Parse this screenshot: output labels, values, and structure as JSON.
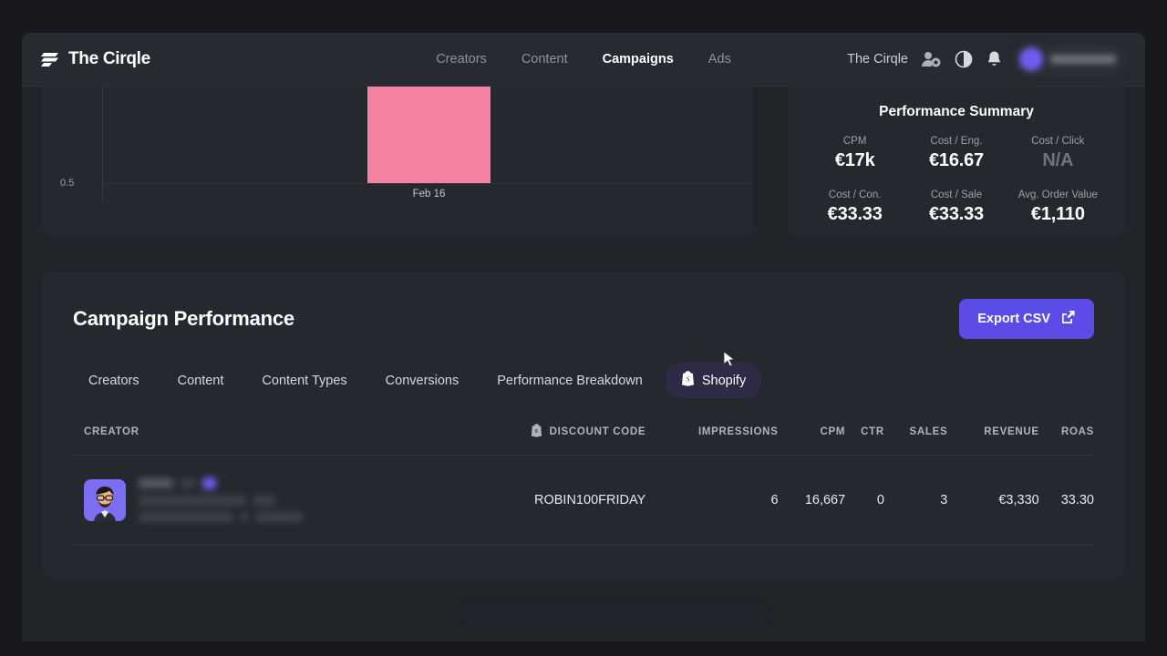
{
  "navbar": {
    "brand": "The Cirqle",
    "brand_icon": "stacked-bars-logo-icon",
    "links": [
      {
        "label": "Creators",
        "active": false
      },
      {
        "label": "Content",
        "active": false
      },
      {
        "label": "Campaigns",
        "active": true
      },
      {
        "label": "Ads",
        "active": false
      }
    ],
    "org_name": "The Cirqle",
    "icons": [
      "user-settings-icon",
      "theme-toggle-icon",
      "notifications-bell-icon"
    ],
    "account_pill": "redacted"
  },
  "chart_data": {
    "type": "bar",
    "title": "",
    "categories": [
      "Feb 16"
    ],
    "values": [
      1
    ],
    "ylabel": "",
    "xlabel": "",
    "ytick_labels": [
      "0.5"
    ],
    "ylim": [
      0,
      1
    ],
    "grid": true,
    "legend": "none",
    "bar_color": "#f4819f",
    "note": "chart is vertically clipped by the sticky header; only the 0.5 gridline and the single Feb 16 bar are visible"
  },
  "summary": {
    "title": "Performance Summary",
    "metrics": [
      {
        "label": "CPM",
        "value": "€17k"
      },
      {
        "label": "Cost / Eng.",
        "value": "€16.67"
      },
      {
        "label": "Cost / Click",
        "value": "N/A"
      },
      {
        "label": "Cost / Con.",
        "value": "€33.33"
      },
      {
        "label": "Cost / Sale",
        "value": "€33.33"
      },
      {
        "label": "Avg. Order Value",
        "value": "€1,110"
      }
    ]
  },
  "performance": {
    "title": "Campaign Performance",
    "export_label": "Export CSV",
    "export_icon": "external-link-icon",
    "tabs": [
      {
        "label": "Creators",
        "active": false,
        "icon": null
      },
      {
        "label": "Content",
        "active": false,
        "icon": null
      },
      {
        "label": "Content Types",
        "active": false,
        "icon": null
      },
      {
        "label": "Conversions",
        "active": false,
        "icon": null
      },
      {
        "label": "Performance Breakdown",
        "active": false,
        "icon": null
      },
      {
        "label": "Shopify",
        "active": true,
        "icon": "shopify-bag-icon"
      }
    ],
    "table": {
      "columns": [
        "CREATOR",
        "DISCOUNT CODE",
        "IMPRESSIONS",
        "CPM",
        "CTR",
        "SALES",
        "REVENUE",
        "ROAS"
      ],
      "discount_code_icon": "shopify-bag-icon",
      "rows": [
        {
          "creator": "redacted",
          "discount_code": "ROBIN100FRIDAY",
          "impressions": "6",
          "cpm": "16,667",
          "ctr": "0",
          "sales": "3",
          "revenue": "€3,330",
          "roas": "33.30"
        }
      ]
    }
  },
  "colors": {
    "page_background": "#17191d",
    "app_background": "#212429",
    "navbar": "#272b31",
    "card": "#25282e",
    "accent_purple": "#5b4ce8",
    "bar_pink": "#f4819f",
    "active_tab": "#2f2b47"
  }
}
